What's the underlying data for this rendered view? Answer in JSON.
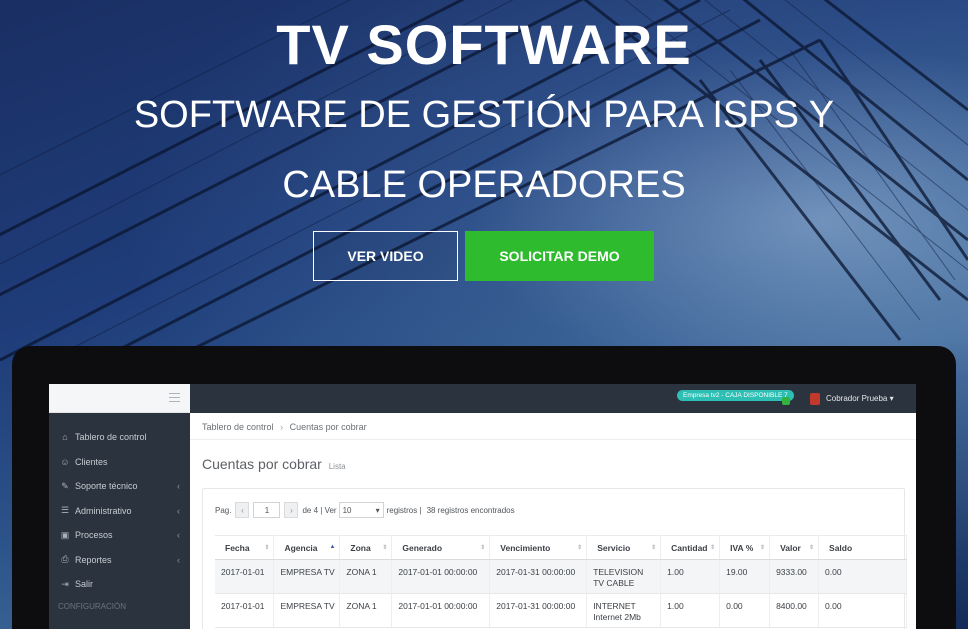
{
  "hero": {
    "title": "TV SOFTWARE",
    "subtitle": "SOFTWARE DE GESTIÓN PARA ISPS Y CABLE OPERADORES",
    "btn_video": "VER VIDEO",
    "btn_demo": "SOLICITAR DEMO",
    "accent": "#2ebb2e"
  },
  "app": {
    "sidebar": {
      "items": [
        {
          "label": "Tablero de control",
          "icon": "home-icon",
          "glyph": "⌂"
        },
        {
          "label": "Clientes",
          "icon": "users-icon",
          "glyph": "☺"
        },
        {
          "label": "Soporte técnico",
          "icon": "wrench-icon",
          "glyph": "✎"
        },
        {
          "label": "Administrativo",
          "icon": "list-icon",
          "glyph": "☰"
        },
        {
          "label": "Procesos",
          "icon": "save-icon",
          "glyph": "▣"
        },
        {
          "label": "Reportes",
          "icon": "print-icon",
          "glyph": "⎙"
        },
        {
          "label": "Salir",
          "icon": "logout-icon",
          "glyph": "⇥"
        }
      ],
      "section": "CONFIGURACIÓN"
    },
    "topbar": {
      "badge": "Empresa tv2 - CAJA DISPONIBLE 7",
      "user": "Cobrador Prueba"
    },
    "breadcrumb": {
      "home": "Tablero de control",
      "current": "Cuentas por cobrar"
    },
    "page_title": "Cuentas por cobrar",
    "page_subtitle": "Lista",
    "pager": {
      "prefix": "Pag.",
      "page": "1",
      "total_text": "de 4 | Ver",
      "per_page": "10",
      "registros": "registros |",
      "found": "38 registros encontrados"
    },
    "table": {
      "headers": [
        "Fecha",
        "Agencia",
        "Zona",
        "Generado",
        "Vencimiento",
        "Servicio",
        "Cantidad",
        "IVA %",
        "Valor",
        "Saldo"
      ],
      "rows": [
        {
          "fecha": "2017-01-01",
          "agencia": "EMPRESA TV",
          "zona": "ZONA 1",
          "generado": "2017-01-01 00:00:00",
          "vencimiento": "2017-01-31 00:00:00",
          "servicio": "TELEVISION",
          "servicio_sub": "TV CABLE",
          "cantidad": "1.00",
          "iva": "19.00",
          "valor": "9333.00",
          "saldo": "0.00"
        },
        {
          "fecha": "2017-01-01",
          "agencia": "EMPRESA TV",
          "zona": "ZONA 1",
          "generado": "2017-01-01 00:00:00",
          "vencimiento": "2017-01-31 00:00:00",
          "servicio": "INTERNET",
          "servicio_sub": "Internet 2Mb",
          "cantidad": "1.00",
          "iva": "0.00",
          "valor": "8400.00",
          "saldo": "0.00"
        }
      ]
    }
  }
}
